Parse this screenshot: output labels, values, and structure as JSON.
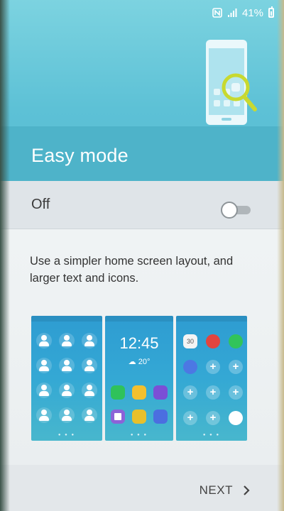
{
  "status_bar": {
    "icons": [
      "nfc-icon",
      "signal-icon",
      "battery-icon"
    ],
    "battery_percent": "41%"
  },
  "header": {
    "title": "Easy mode",
    "illustration_icon": "phone-search-icon",
    "colors": {
      "background": "#5dc1d6",
      "band": "#4eb3c9",
      "accent": "#c8d930"
    }
  },
  "setting": {
    "label": "Off",
    "enabled": false
  },
  "description": "Use a simpler home screen layout, and larger text and icons.",
  "previews": {
    "lock_screen_time": "12:45",
    "lock_screen_weather": "20°",
    "calendar_day": "30"
  },
  "footer": {
    "next_label": "NEXT",
    "next_icon": "chevron-right-icon"
  }
}
